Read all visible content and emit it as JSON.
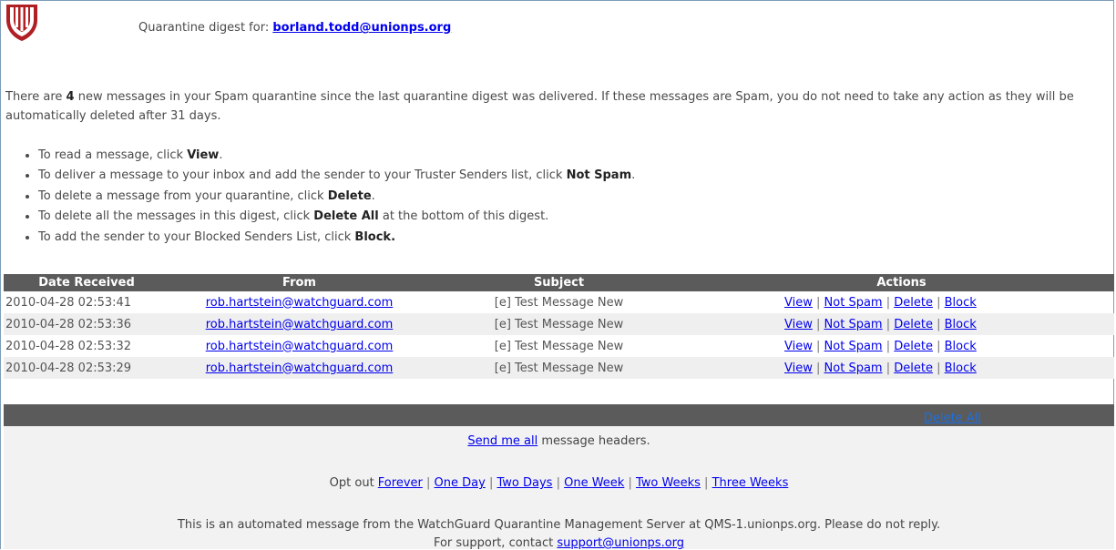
{
  "header": {
    "digest_label": "Quarantine digest for:",
    "recipient": "borland.todd@unionps.org"
  },
  "intro": {
    "p_before": "There are ",
    "count": "4",
    "p_after": " new messages in your Spam quarantine since the last quarantine digest was delivered. If these messages are Spam, you do not need to take any action as they will be automatically deleted after 31 days."
  },
  "instructions": [
    {
      "before": "To read a message, click ",
      "action": "View",
      "after": "."
    },
    {
      "before": "To deliver a message to your inbox and add the sender to your Truster Senders list, click ",
      "action": "Not Spam",
      "after": "."
    },
    {
      "before": "To delete a message from your quarantine, click ",
      "action": "Delete",
      "after": "."
    },
    {
      "before": "To delete all the messages in this digest, click ",
      "action": "Delete All",
      "after": " at the bottom of this digest."
    },
    {
      "before": "To add the sender to your Blocked Senders List, click ",
      "action": "Block.",
      "after": ""
    }
  ],
  "table": {
    "headers": [
      "Date Received",
      "From",
      "Subject",
      "Actions"
    ],
    "rows": [
      {
        "date": "2010-04-28 02:53:41",
        "from": "rob.hartstein@watchguard.com",
        "subject": "[e] Test Message New"
      },
      {
        "date": "2010-04-28 02:53:36",
        "from": "rob.hartstein@watchguard.com",
        "subject": "[e] Test Message New"
      },
      {
        "date": "2010-04-28 02:53:32",
        "from": "rob.hartstein@watchguard.com",
        "subject": "[e] Test Message New"
      },
      {
        "date": "2010-04-28 02:53:29",
        "from": "rob.hartstein@watchguard.com",
        "subject": "[e] Test Message New"
      }
    ],
    "actions": [
      "View",
      "Not Spam",
      "Delete",
      "Block"
    ],
    "action_separator": "|"
  },
  "footer": {
    "delete_all": "Delete All",
    "send_me_all": "Send me all",
    "send_me_all_suffix": " message headers.",
    "opt_out_label": "Opt out ",
    "opt_out_options": [
      "Forever",
      "One Day",
      "Two Days",
      "One Week",
      "Two Weeks",
      "Three Weeks"
    ],
    "automated_notice": "This is an automated message from the WatchGuard Quarantine Management Server at QMS-1.unionps.org. Please do not reply.",
    "support_prefix": "For support, contact ",
    "support_email": "support@unionps.org"
  },
  "colors": {
    "header_bar": "#5b5b5b",
    "alt_row": "#efefef",
    "footer_bg": "#f2f2f2",
    "logo_red": "#b01f24",
    "link": "#0000ee"
  },
  "icons": {
    "logo": "union-public-schools-logo"
  }
}
